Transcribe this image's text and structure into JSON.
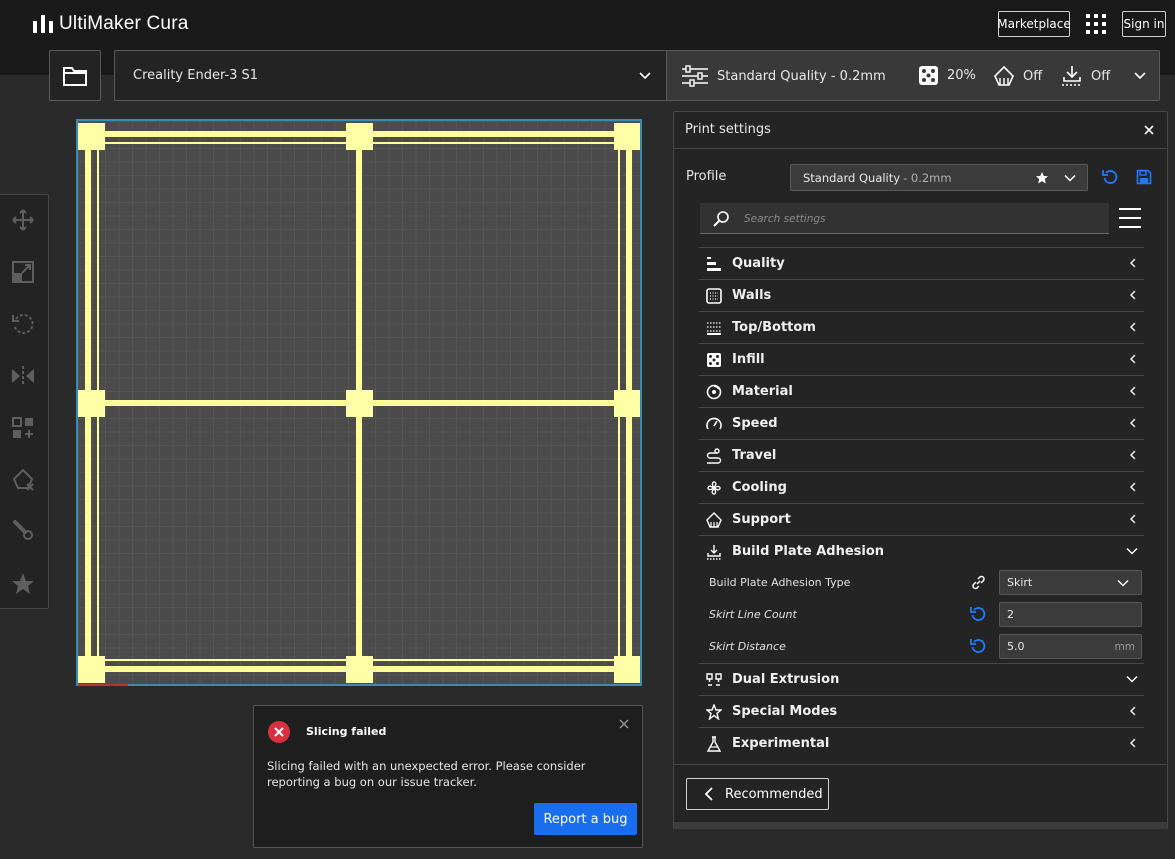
{
  "app": {
    "name": "UltiMaker Cura"
  },
  "header": {
    "marketplace_label": "Marketplace",
    "signin_label": "Sign in"
  },
  "toolbar": {
    "printer": "Creality Ender-3 S1",
    "quality": "Standard Quality - 0.2mm",
    "infill": "20%",
    "support": "Off",
    "adhesion": "Off"
  },
  "toast": {
    "title": "Slicing failed",
    "message": "Slicing failed with an unexpected error. Please consider reporting a bug on our issue tracker.",
    "button": "Report a bug"
  },
  "panel": {
    "title": "Print settings",
    "profile_label": "Profile",
    "profile_name": "Standard Quality",
    "profile_sub": "- 0.2mm",
    "search_placeholder": "Search settings",
    "categories": [
      {
        "label": "Quality",
        "icon": "quality-icon"
      },
      {
        "label": "Walls",
        "icon": "walls-icon"
      },
      {
        "label": "Top/Bottom",
        "icon": "top-bottom-icon"
      },
      {
        "label": "Infill",
        "icon": "infill-icon"
      },
      {
        "label": "Material",
        "icon": "material-icon"
      },
      {
        "label": "Speed",
        "icon": "speed-icon"
      },
      {
        "label": "Travel",
        "icon": "travel-icon"
      },
      {
        "label": "Cooling",
        "icon": "cooling-icon"
      },
      {
        "label": "Support",
        "icon": "support-icon"
      },
      {
        "label": "Build Plate Adhesion",
        "icon": "adhesion-icon",
        "expanded": true
      }
    ],
    "adhesion_settings": {
      "type_label": "Build Plate Adhesion Type",
      "type_value": "Skirt",
      "line_count_label": "Skirt Line Count",
      "line_count_value": "2",
      "distance_label": "Skirt Distance",
      "distance_value": "5.0",
      "distance_unit": "mm"
    },
    "categories_after": [
      {
        "label": "Dual Extrusion",
        "icon": "dual-extrusion-icon",
        "chevron": "down"
      },
      {
        "label": "Special Modes",
        "icon": "special-modes-icon"
      },
      {
        "label": "Experimental",
        "icon": "experimental-icon"
      }
    ],
    "footer_button": "Recommended"
  },
  "colors": {
    "accent": "#196ef0",
    "error": "#d9303f",
    "model": "#ffff99",
    "build_plate_border": "#3a8bb0"
  }
}
